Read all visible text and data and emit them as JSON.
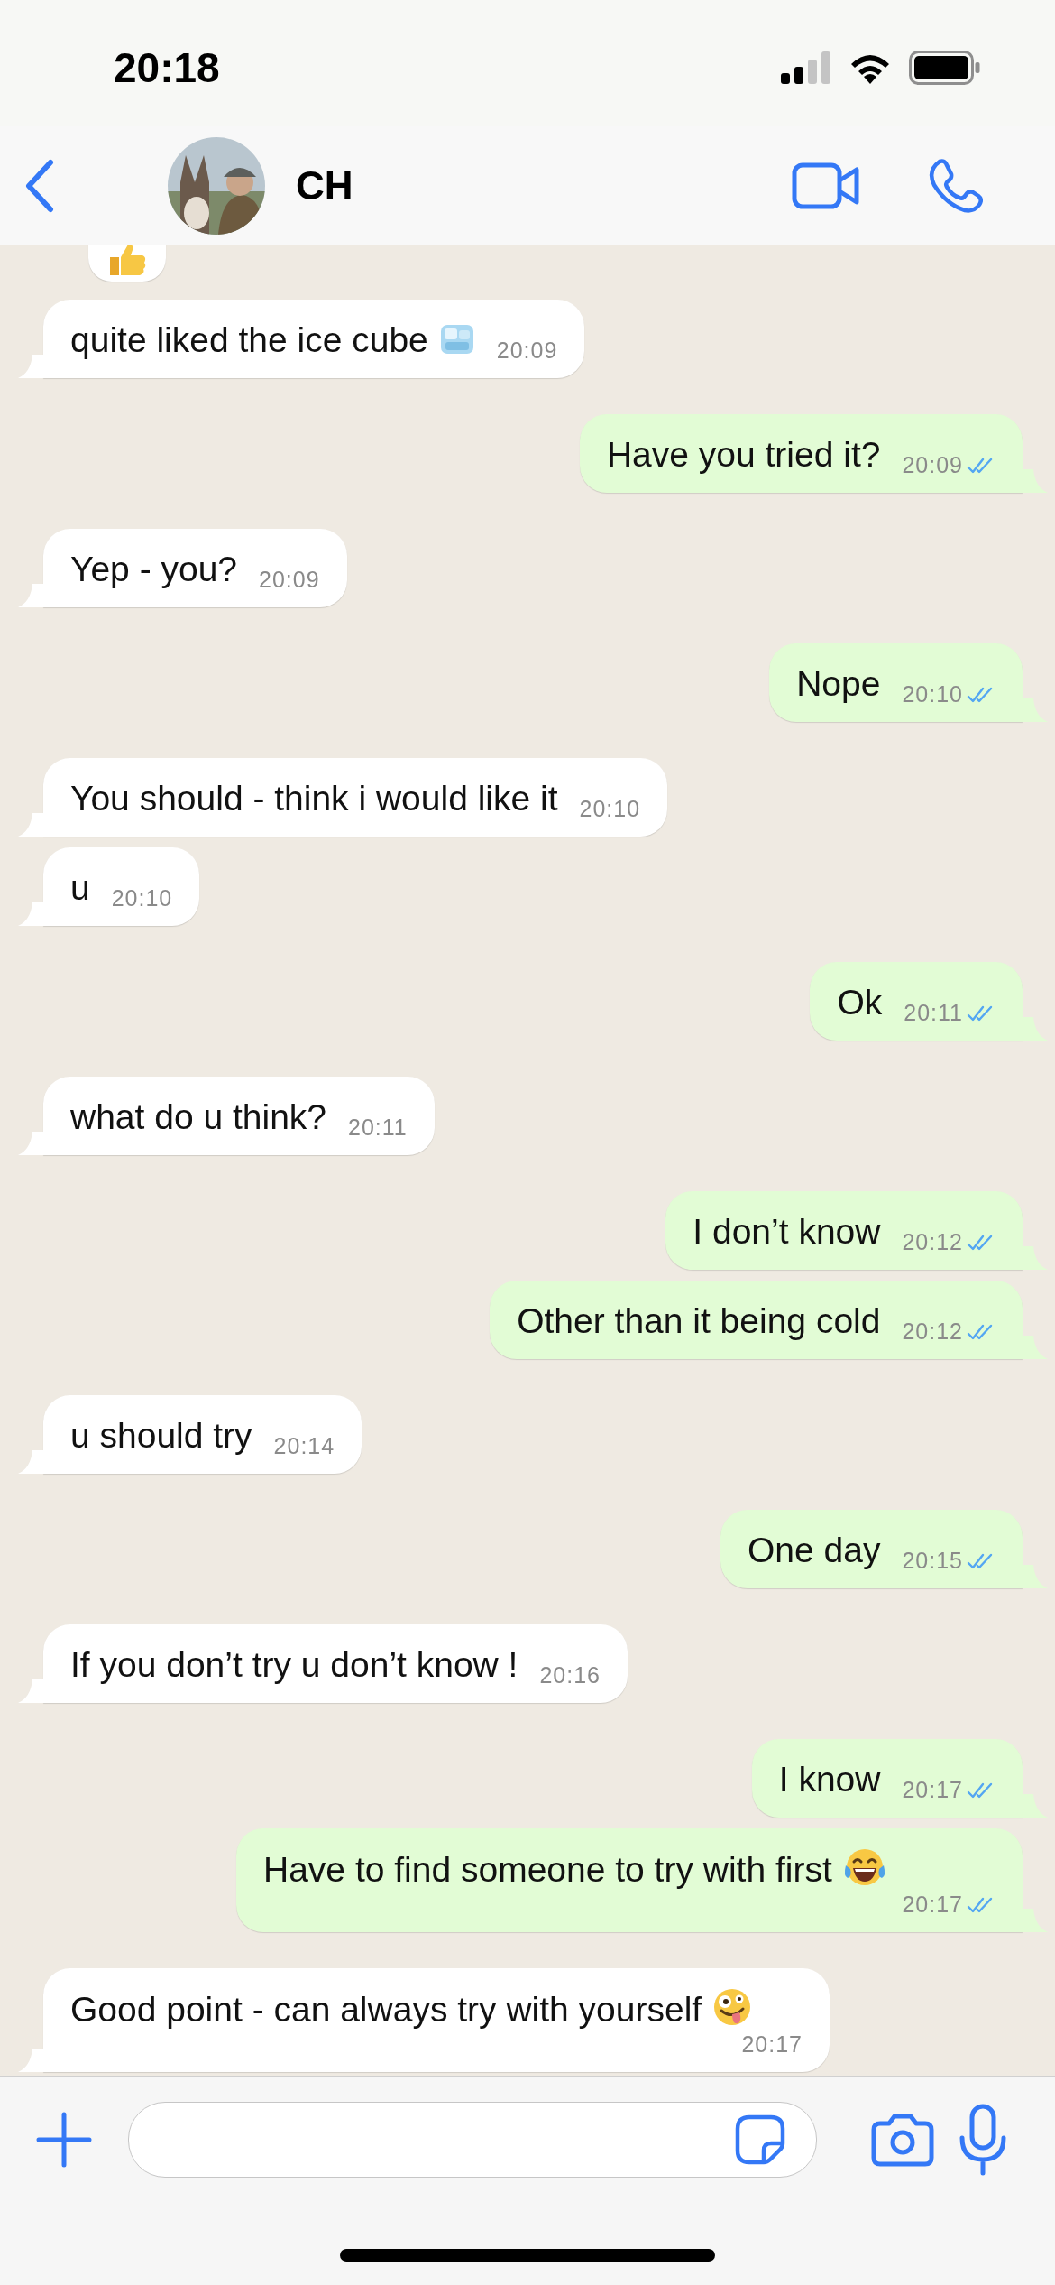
{
  "status_bar": {
    "time": "20:18"
  },
  "header": {
    "contact_name": "CH"
  },
  "messages": [
    {
      "kind": "received",
      "text": "quite liked the ice cube",
      "time": "20:09"
    },
    {
      "kind": "sent",
      "text": "Have you tried it?",
      "time": "20:09",
      "read": true
    },
    {
      "kind": "received",
      "text": "Yep - you?",
      "time": "20:09"
    },
    {
      "kind": "sent",
      "text": "Nope",
      "time": "20:10",
      "read": true
    },
    {
      "kind": "received",
      "text": "You should - think i would like it",
      "time": "20:10"
    },
    {
      "kind": "received",
      "text": "u",
      "time": "20:10"
    },
    {
      "kind": "sent",
      "text": "Ok",
      "time": "20:11",
      "read": true
    },
    {
      "kind": "received",
      "text": "what do u think?",
      "time": "20:11"
    },
    {
      "kind": "sent",
      "text": "I don’t know",
      "time": "20:12",
      "read": true
    },
    {
      "kind": "sent",
      "text": "Other than it being cold",
      "time": "20:12",
      "read": true
    },
    {
      "kind": "received",
      "text": "u should try",
      "time": "20:14"
    },
    {
      "kind": "sent",
      "text": "One day",
      "time": "20:15",
      "read": true
    },
    {
      "kind": "received",
      "text": "If you don’t try u don’t know !",
      "time": "20:16"
    },
    {
      "kind": "sent",
      "text": "I know",
      "time": "20:17",
      "read": true
    },
    {
      "kind": "sent",
      "text": "Have to find someone to try with first",
      "time": "20:17",
      "read": true
    },
    {
      "kind": "received",
      "text": "Good point - can always try with yourself",
      "time": "20:17"
    }
  ]
}
